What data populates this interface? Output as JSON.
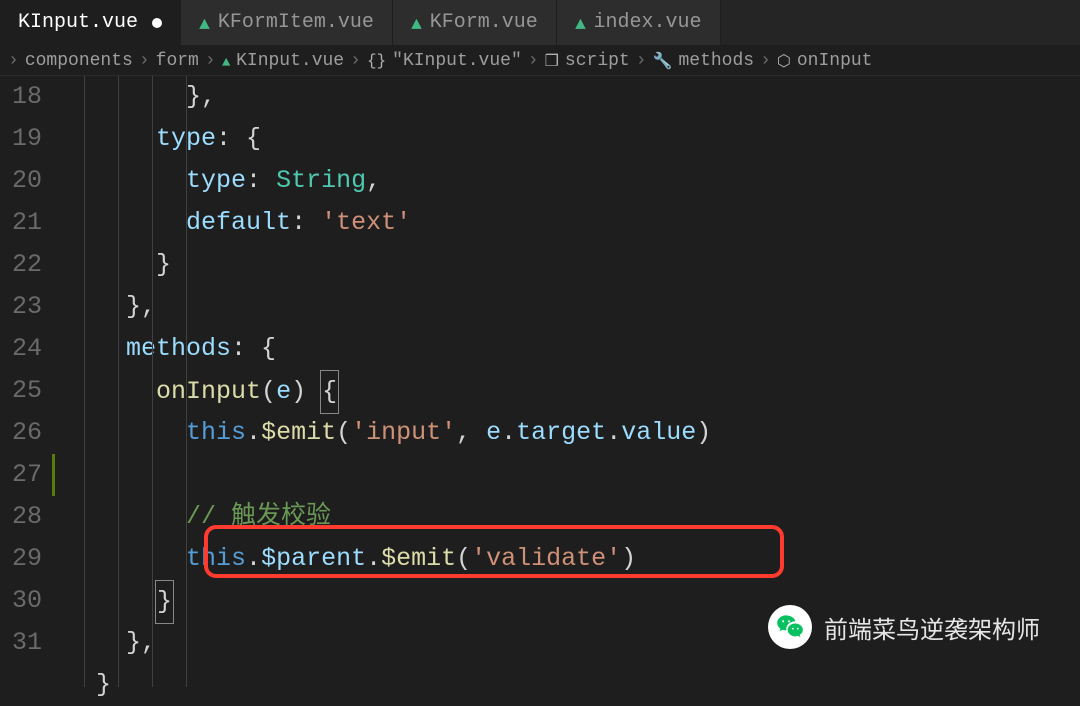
{
  "tabs": [
    {
      "label": "KInput.vue",
      "active": true,
      "modified": true
    },
    {
      "label": "KFormItem.vue",
      "active": false,
      "modified": false
    },
    {
      "label": "KForm.vue",
      "active": false,
      "modified": false
    },
    {
      "label": "index.vue",
      "active": false,
      "modified": false
    }
  ],
  "breadcrumb": {
    "items": [
      {
        "text": "",
        "icon": null
      },
      {
        "text": "components",
        "icon": null
      },
      {
        "text": "form",
        "icon": null
      },
      {
        "text": "KInput.vue",
        "icon": "vue"
      },
      {
        "text": "\"KInput.vue\"",
        "icon": "braces"
      },
      {
        "text": "script",
        "icon": "cube"
      },
      {
        "text": "methods",
        "icon": "wrench"
      },
      {
        "text": "onInput",
        "icon": "box"
      }
    ]
  },
  "lineNumbers": [
    "18",
    "19",
    "20",
    "21",
    "22",
    "23",
    "24",
    "25",
    "26",
    "27",
    "28",
    "29",
    "30",
    "31"
  ],
  "code": {
    "l0_close": "},",
    "type_key": "type",
    "colon_brace": ": {",
    "type_inner": "type",
    "String": "String",
    "comma": ",",
    "default_key": "default",
    "text_str": "'text'",
    "close_brace": "}",
    "close_brace_comma": "},",
    "methods_key": "methods",
    "onInput": "onInput",
    "param_e": "e",
    "this": "this",
    "emit": "$emit",
    "input_str": "'input'",
    "e_target_value": "e.target.value",
    "comment": "// 触发校验",
    "parent": "$parent",
    "validate_str": "'validate'",
    "close_paren": ")",
    "open_paren": "("
  },
  "watermark": "前端菜鸟逆袭架构师"
}
